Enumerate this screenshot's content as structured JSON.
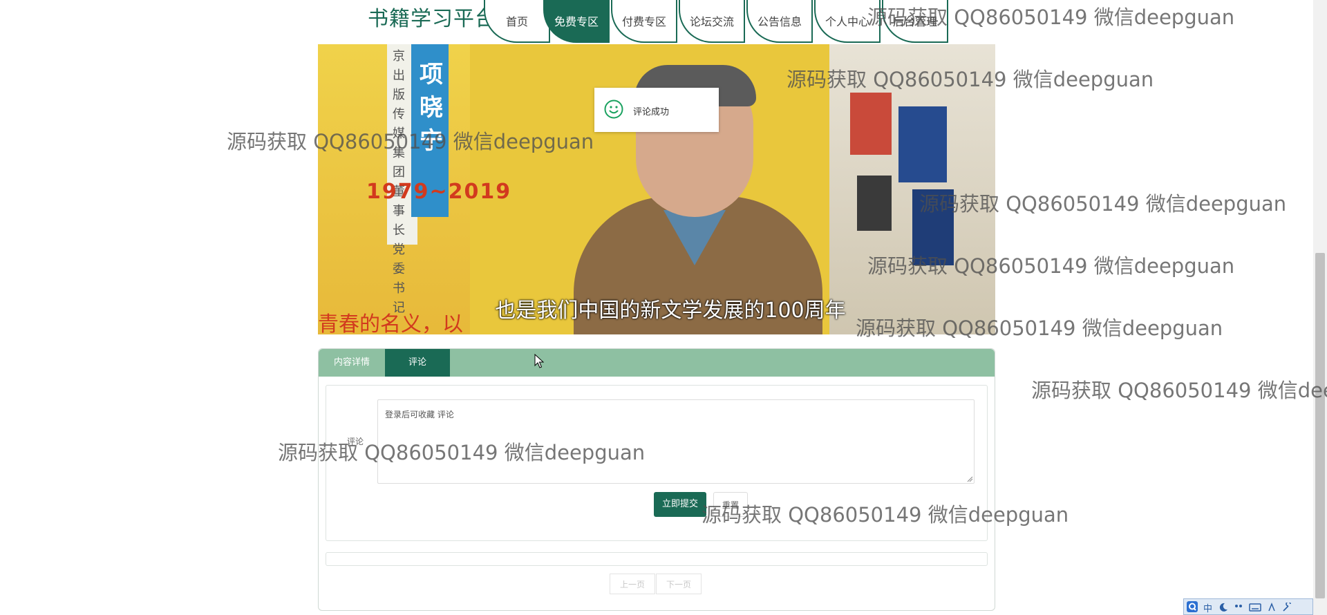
{
  "nav": {
    "brand": "书籍学习平台",
    "items": [
      {
        "label": "首页"
      },
      {
        "label": "免费专区",
        "active": true
      },
      {
        "label": "付费专区"
      },
      {
        "label": "论坛交流"
      },
      {
        "label": "公告信息"
      },
      {
        "label": "个人中心"
      },
      {
        "label": "后台管理"
      }
    ]
  },
  "video": {
    "strip_text": "京出版传媒集团董事长党委书记",
    "name_text": "项晓宁",
    "year_text": "1979~2019",
    "subtitle": "也是我们中国的新文学发展的100周年",
    "red_caption": "青春的名义，以"
  },
  "toast": {
    "text": "评论成功"
  },
  "tabs": [
    {
      "label": "内容详情"
    },
    {
      "label": "评论",
      "active": true
    }
  ],
  "comment_form": {
    "label": "评论",
    "textarea_value": "登录后可收藏 评论",
    "submit_label": "立即提交",
    "reset_label": "重置"
  },
  "pager": {
    "prev_label": "上一页",
    "next_label": "下一页"
  },
  "ime": {
    "lang_label": "中"
  },
  "watermark": "源码获取 QQ86050149 微信deepguan"
}
